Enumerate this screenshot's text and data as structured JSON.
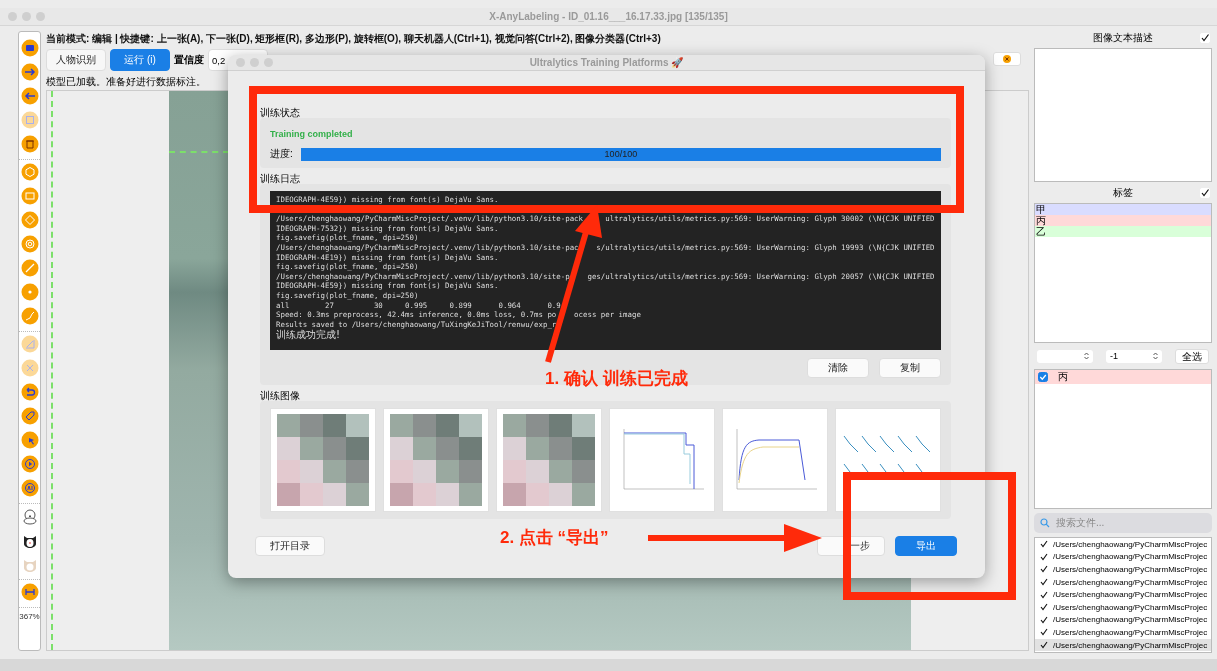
{
  "window": {
    "title": "X-AnyLabeling - ID_01.16___16.17.33.jpg [135/135]"
  },
  "left_toolbar": {
    "groups": [
      {
        "tools": [
          {
            "kind": "folder",
            "disabled": false
          },
          {
            "kind": "next",
            "disabled": false
          },
          {
            "kind": "prev",
            "disabled": false
          },
          {
            "kind": "save",
            "disabled": true
          },
          {
            "kind": "trash",
            "disabled": false
          }
        ]
      },
      {
        "tools": [
          {
            "kind": "polygon",
            "disabled": false
          },
          {
            "kind": "rect",
            "disabled": false
          },
          {
            "kind": "rotation",
            "disabled": false
          },
          {
            "kind": "circle",
            "disabled": false
          },
          {
            "kind": "line",
            "disabled": false
          },
          {
            "kind": "point",
            "disabled": false
          },
          {
            "kind": "linestrip",
            "disabled": false
          }
        ]
      },
      {
        "tools": [
          {
            "kind": "edit",
            "disabled": true
          },
          {
            "kind": "cross",
            "disabled": true
          },
          {
            "kind": "undo",
            "disabled": false
          },
          {
            "kind": "tag",
            "disabled": false
          },
          {
            "kind": "cursor",
            "disabled": false
          },
          {
            "kind": "play",
            "disabled": false
          },
          {
            "kind": "ai",
            "disabled": false
          }
        ]
      },
      {
        "tools": [
          {
            "kind": "duck",
            "disabled": false
          },
          {
            "kind": "dog",
            "disabled": false
          },
          {
            "kind": "cat",
            "disabled": false
          }
        ]
      },
      {
        "tools": [
          {
            "kind": "fit",
            "disabled": false
          }
        ]
      }
    ],
    "zoom": "367%"
  },
  "hint": "当前模式: 编辑 | 快捷键: 上一张(A), 下一张(D), 矩形框(R), 多边形(P), 旋转框(O), 聊天机器人(Ctrl+1), 视觉问答(Ctrl+2), 图像分类器(Ctrl+3)",
  "toolbar": {
    "buttons": [
      {
        "label": "人物识别",
        "selected": false
      },
      {
        "label": "运行 (i)",
        "selected": true
      }
    ],
    "confidence_label": "置信度",
    "confidence_value": "0,2"
  },
  "status": "模型已加载。准备好进行数据标注。",
  "dialog": {
    "title": "Ultralytics Training Platforms 🚀",
    "status_section": {
      "title": "训练状态",
      "message": "Training completed",
      "progress_label": "进度:",
      "level": 1,
      "progress_text": "100/100"
    },
    "log_section": {
      "title": "训练日志",
      "head_lines": [
        "IDEOGRAPH-4E59}) missing from font(s) DejaVu Sans."
      ],
      "lines": [
        "/Users/chenghaowang/PyCharmMiscProject/.venv/lib/python3.10/site-pack     ultralytics/utils/metrics.py:569: UserWarning: Glyph 30002 (\\N{CJK UNIFIED",
        "IDEOGRAPH-7532}) missing from font(s) DejaVu Sans.",
        "fig.savefig(plot_fname, dpi=250)",
        "/Users/chenghaowang/PyCharmMiscProject/.venv/lib/python3.10/site-pac    s/ultralytics/utils/metrics.py:569: UserWarning: Glyph 19993 (\\N{CJK UNIFIED",
        "IDEOGRAPH-4E19}) missing from font(s) DejaVu Sans.",
        "fig.savefig(plot_fname, dpi=250)",
        "/Users/chenghaowang/PyCharmMiscProject/.venv/lib/python3.10/site-p    ges/ultralytics/utils/metrics.py:569: UserWarning: Glyph 20057 (\\N{CJK UNIFIED",
        "IDEOGRAPH-4E59}) missing from font(s) DejaVu Sans.",
        "fig.savefig(plot_fname, dpi=250)",
        "all        27         30     0.995     0.899      0.964      0.9",
        "Speed: 0.3ms preprocess, 42.4ms inference, 0.0ms loss, 0.7ms po    ocess per image",
        "Results saved to /Users/chenghaowang/TuXingKeJiTool/renwu/exp_r"
      ],
      "result_line": "训练成功完成!",
      "buttons": [
        "清除",
        "复制"
      ]
    },
    "images_section": {
      "title": "训练图像",
      "images": [
        {
          "kind": "mosaic"
        },
        {
          "kind": "mosaic"
        },
        {
          "kind": "mosaic"
        },
        {
          "kind": "step_curve"
        },
        {
          "kind": "plateau_curve"
        },
        {
          "kind": "grid_plots"
        }
      ]
    },
    "footer": {
      "open_button": "打开目录",
      "back_button": "一步",
      "export_button": "导出"
    }
  },
  "right_panel": {
    "description": {
      "title": "图像文本描述",
      "checked": true
    },
    "labels": {
      "title": "标签",
      "checked": true,
      "items": [
        {
          "text": "甲",
          "color": "#d9dcff"
        },
        {
          "text": "丙",
          "color": "#ffd9d9"
        },
        {
          "text": "乙",
          "color": "#d9ffd9"
        }
      ]
    },
    "controls": {
      "select_2": "-1",
      "select_all": "全选"
    },
    "shapes": [
      {
        "text": "丙",
        "checked": true,
        "color": "#ffd9d9"
      }
    ],
    "search": {
      "placeholder": "搜索文件..."
    },
    "files": [
      {
        "path": "/Users/chenghaowang/PyCharmMiscProjec",
        "checked": true,
        "selected": false
      },
      {
        "path": "/Users/chenghaowang/PyCharmMiscProjec",
        "checked": true,
        "selected": false
      },
      {
        "path": "/Users/chenghaowang/PyCharmMiscProjec",
        "checked": true,
        "selected": false
      },
      {
        "path": "/Users/chenghaowang/PyCharmMiscProjec",
        "checked": true,
        "selected": false
      },
      {
        "path": "/Users/chenghaowang/PyCharmMiscProjec",
        "checked": true,
        "selected": false
      },
      {
        "path": "/Users/chenghaowang/PyCharmMiscProjec",
        "checked": true,
        "selected": false
      },
      {
        "path": "/Users/chenghaowang/PyCharmMiscProjec",
        "checked": true,
        "selected": false
      },
      {
        "path": "/Users/chenghaowang/PyCharmMiscProjec",
        "checked": true,
        "selected": false
      },
      {
        "path": "/Users/chenghaowang/PyCharmMiscProjec",
        "checked": true,
        "selected": true
      }
    ]
  },
  "annotations": [
    {
      "text": "1. 确认 训练已完成"
    },
    {
      "text": "2. 点击 “导出”"
    }
  ]
}
